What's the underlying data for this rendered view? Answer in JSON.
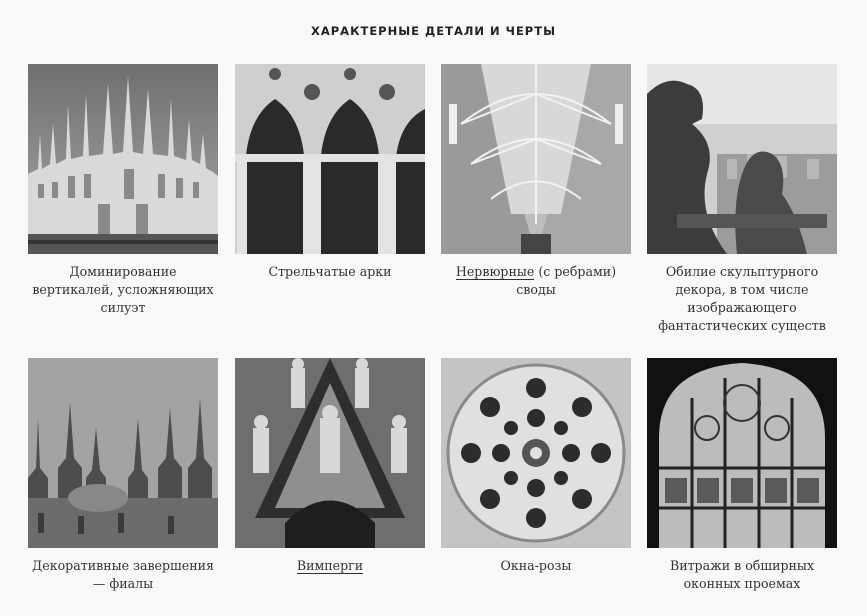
{
  "section_title": "ХАРАКТЕРНЫЕ ДЕТАЛИ И ЧЕРТЫ",
  "items": [
    {
      "caption": "Доминирование вертикалей, усложняющих силуэт",
      "image_icon": "cathedral-facade-photo"
    },
    {
      "caption": "Стрельчатые арки",
      "image_icon": "pointed-arches-photo"
    },
    {
      "link": "Нервюрные",
      "caption_rest": " (с ребрами) своды",
      "image_icon": "rib-vault-photo"
    },
    {
      "caption": "Обилие скульптурного декора, в том числе изображающего фантастических существ",
      "image_icon": "gargoyle-photo"
    },
    {
      "caption": "Декоративные завершения — фиалы",
      "image_icon": "pinnacles-photo"
    },
    {
      "link": "Вимперги",
      "image_icon": "gable-sculpture-photo"
    },
    {
      "caption": "Окна-розы",
      "image_icon": "rose-window-photo"
    },
    {
      "caption": "Витражи в обширных оконных проемах",
      "image_icon": "stained-glass-photo"
    }
  ]
}
